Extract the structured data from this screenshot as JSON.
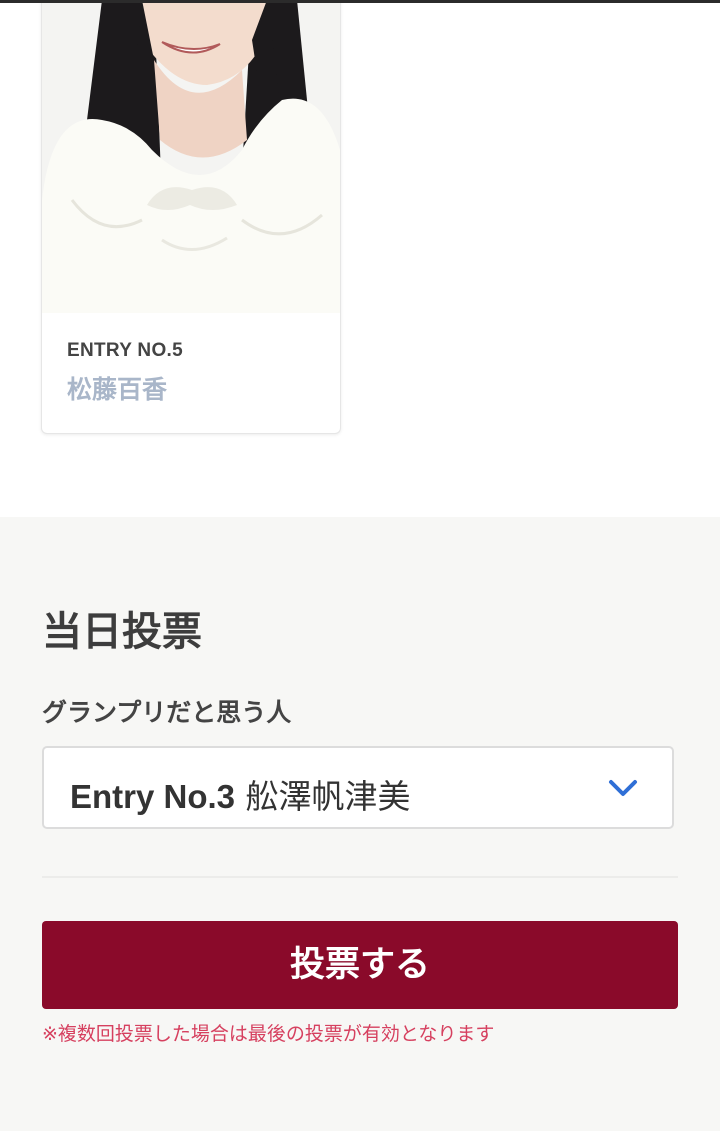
{
  "entry_card": {
    "entry_number": "ENTRY NO.5",
    "name": "松藤百香"
  },
  "vote_section": {
    "title": "当日投票",
    "field_label": "グランプリだと思う人",
    "select": {
      "selected_entry": "Entry No.3",
      "selected_name": "舩澤帆津美",
      "icon": "chevron-down-icon"
    },
    "submit_label": "投票する",
    "note": "※複数回投票した場合は最後の投票が有効となります"
  },
  "colors": {
    "primary_button": "#8a0a2a",
    "note_text": "#d6405f",
    "entry_name": "#a9b6c9",
    "chevron": "#2f6fd6",
    "section_background": "#f7f7f5"
  }
}
